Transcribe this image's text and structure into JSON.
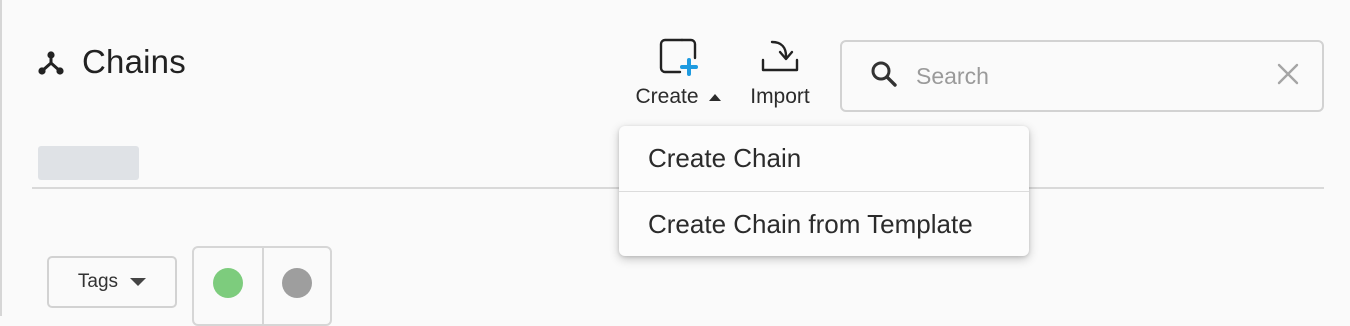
{
  "header": {
    "title": "Chains",
    "title_icon": "chain-fork-icon"
  },
  "toolbar": {
    "create_label": "Create",
    "create_icon": "add-square-icon",
    "import_label": "Import",
    "import_icon": "import-tray-icon"
  },
  "search": {
    "placeholder": "Search",
    "value": "",
    "icon": "search-icon",
    "clear_icon": "close-icon"
  },
  "filters": {
    "tags_label": "Tags",
    "status_options": [
      {
        "name": "active",
        "color": "#7dcc7d"
      },
      {
        "name": "inactive",
        "color": "#9e9e9e"
      }
    ]
  },
  "create_menu": {
    "open": true,
    "items": [
      {
        "label": "Create Chain"
      },
      {
        "label": "Create Chain from Template"
      }
    ]
  },
  "colors": {
    "accent": "#1e9be0",
    "background": "#fafafa",
    "border": "#d2d2d2"
  }
}
